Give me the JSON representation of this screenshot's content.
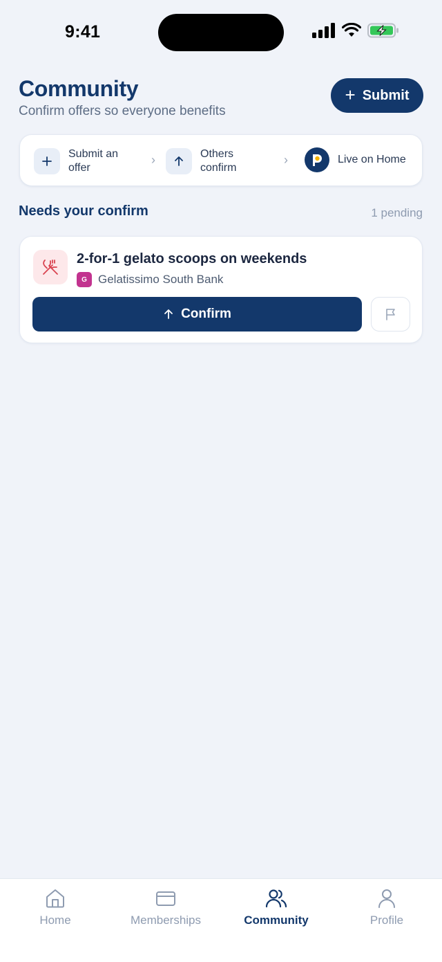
{
  "status_bar": {
    "time": "9:41"
  },
  "header": {
    "title": "Community",
    "subtitle": "Confirm offers so everyone benefits",
    "submit_label": "Submit"
  },
  "steps": [
    {
      "label": "Submit an\noffer",
      "icon": "plus-icon"
    },
    {
      "label": "Others\nconfirm",
      "icon": "arrow-up-icon"
    },
    {
      "label": "Live on Home",
      "icon": "app-logo-icon"
    }
  ],
  "section": {
    "title": "Needs your confirm",
    "count": "1 pending"
  },
  "offer": {
    "title": "2-for-1 gelato scoops on weekends",
    "merchant_initial": "G",
    "merchant_name": "Gelatissimo South Bank",
    "confirm_label": "Confirm",
    "category_icon": "utensils-crossed-icon"
  },
  "tabs": [
    {
      "label": "Home",
      "icon": "home-icon",
      "active": false
    },
    {
      "label": "Memberships",
      "icon": "card-icon",
      "active": false
    },
    {
      "label": "Community",
      "icon": "users-icon",
      "active": true
    },
    {
      "label": "Profile",
      "icon": "user-icon",
      "active": false
    }
  ],
  "colors": {
    "primary": "#13386b",
    "background": "#f0f3f9",
    "merchant_badge": "#c2338f",
    "offer_icon_bg": "#fde8ea",
    "offer_icon": "#d9424f",
    "battery": "#34c759"
  }
}
